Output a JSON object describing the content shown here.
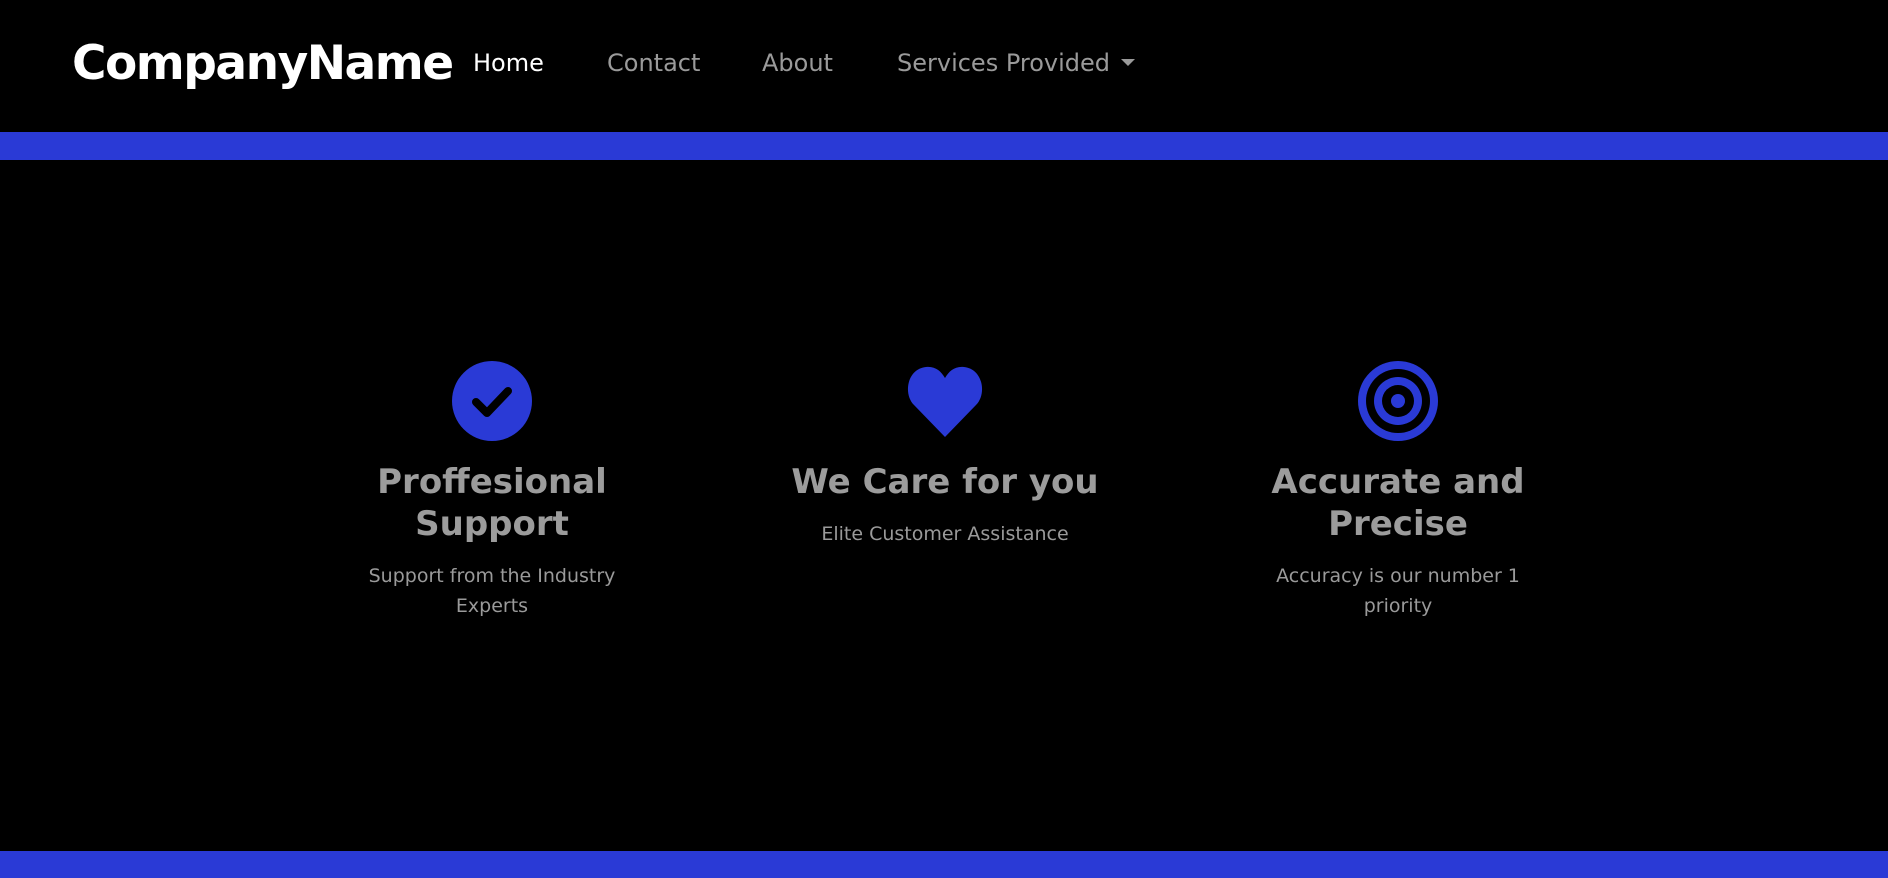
{
  "navbar": {
    "brand": "CompanyName",
    "links": [
      {
        "label": "Home",
        "active": true
      },
      {
        "label": "Contact",
        "active": false
      },
      {
        "label": "About",
        "active": false
      },
      {
        "label": "Services Provided",
        "active": false,
        "dropdown": true
      }
    ]
  },
  "colors": {
    "background": "#000000",
    "accent": "#2a3ad6",
    "brand_text": "#ffffff",
    "muted_text": "#9a9a9a"
  },
  "features": [
    {
      "icon": "check-circle-icon",
      "title": "Proffesional Support",
      "description": "Support from the Industry Experts"
    },
    {
      "icon": "heart-icon",
      "title": "We Care for you",
      "description": "Elite Customer Assistance"
    },
    {
      "icon": "bullseye-icon",
      "title": "Accurate and Precise",
      "description": "Accuracy is our number 1 priority"
    }
  ]
}
